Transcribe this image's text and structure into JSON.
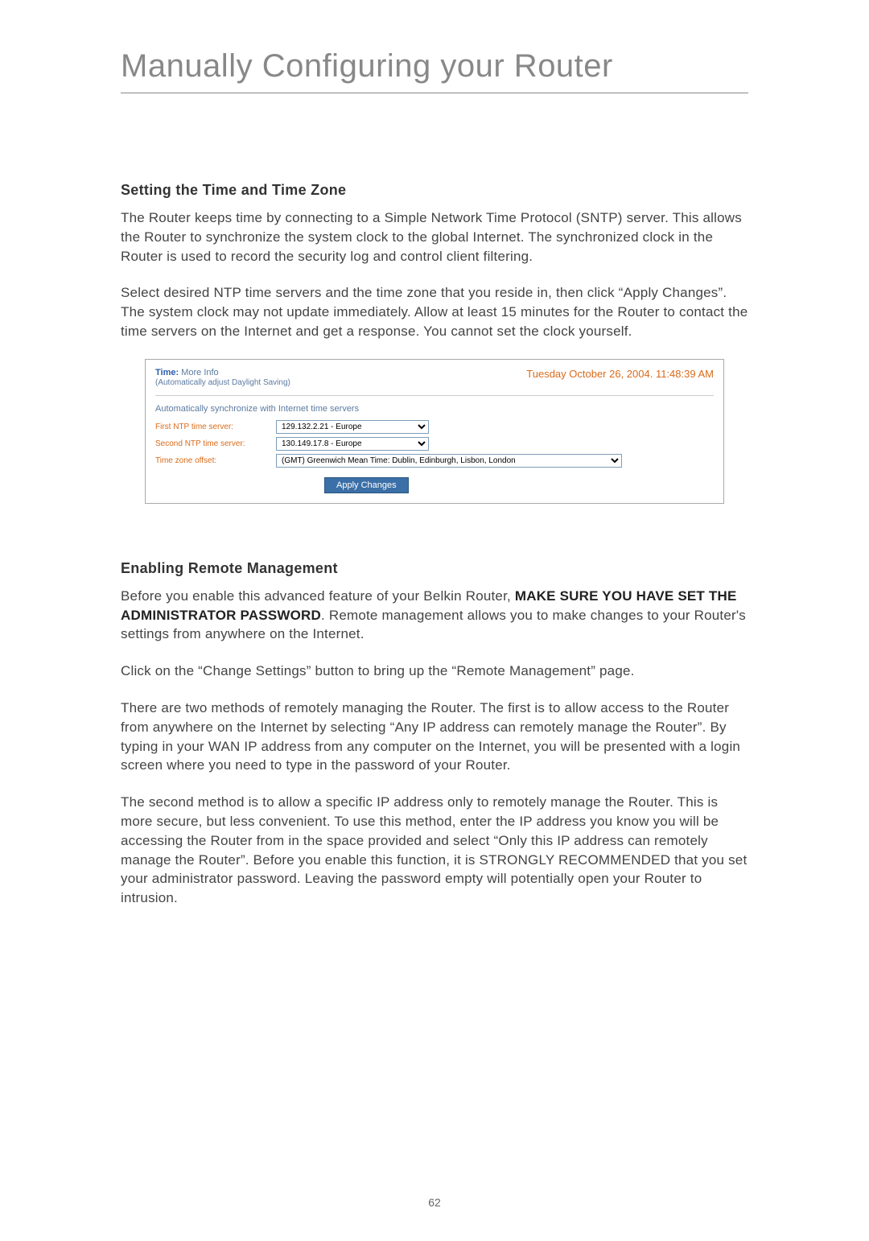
{
  "page_title": "Manually Configuring your Router",
  "section1": {
    "heading": "Setting the Time and Time Zone",
    "para1": "The Router keeps time by connecting to a Simple Network Time Protocol (SNTP) server. This allows the Router to synchronize the system clock to the global Internet. The synchronized clock in the Router is used to record the security log and control client filtering.",
    "para2": "Select desired NTP time servers and the time zone that you reside in, then click “Apply Changes”. The system clock may not update immediately. Allow at least 15 minutes for the Router to contact the time servers on the Internet and get a response. You cannot set the clock yourself."
  },
  "screenshot": {
    "time_label": "Time: ",
    "more_info": "More Info",
    "daylight": "(Automatically adjust Daylight Saving)",
    "datetime": "Tuesday October 26, 2004.  11:48:39 AM",
    "auto_sync": "Automatically synchronize with Internet time servers",
    "first_ntp_label": "First NTP time server:",
    "first_ntp_value": "129.132.2.21 - Europe",
    "second_ntp_label": "Second NTP time server:",
    "second_ntp_value": "130.149.17.8 - Europe",
    "tz_label": "Time zone offset:",
    "tz_value": "(GMT) Greenwich Mean Time: Dublin, Edinburgh, Lisbon, London",
    "apply_btn": "Apply Changes"
  },
  "section2": {
    "heading": "Enabling Remote Management",
    "para1_pre": "Before you enable this advanced feature of your Belkin Router, ",
    "para1_bold": "MAKE SURE YOU HAVE SET THE ADMINISTRATOR PASSWORD",
    "para1_post": ". Remote management allows you to make changes to your Router's settings from anywhere on the Internet.",
    "para2": "Click on the “Change Settings” button to bring up the “Remote Management” page.",
    "para3": "There are two methods of remotely managing the Router. The first is to allow access to the Router from anywhere on the Internet by selecting “Any IP address can remotely manage the Router”. By typing in your WAN IP address from any computer on the Internet, you will be presented with a login screen where you need to type in the password of your Router.",
    "para4": "The second method is to allow a specific IP address only to remotely manage the Router. This is more secure, but less convenient. To use this method, enter the IP address you know you will be accessing the Router from in the space provided and select “Only this IP address can remotely manage the Router”. Before you enable this function, it is STRONGLY RECOMMENDED that you set your administrator password. Leaving the password empty will potentially open your Router to intrusion."
  },
  "page_number": "62"
}
